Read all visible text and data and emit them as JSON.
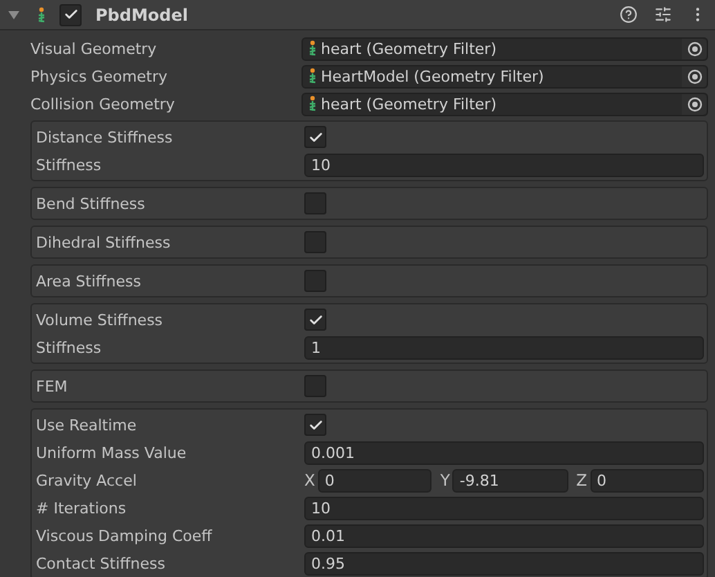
{
  "component": {
    "title": "PbdModel",
    "enabled": true,
    "expanded": true
  },
  "object_fields": [
    {
      "label": "Visual Geometry",
      "value": "heart (Geometry Filter)"
    },
    {
      "label": "Physics Geometry",
      "value": "HeartModel (Geometry Filter)"
    },
    {
      "label": "Collision Geometry",
      "value": "heart (Geometry Filter)"
    }
  ],
  "groups": [
    {
      "rows": [
        {
          "kind": "checkbox",
          "label": "Distance Stiffness",
          "checked": true
        },
        {
          "kind": "text",
          "label": "Stiffness",
          "value": "10"
        }
      ]
    },
    {
      "rows": [
        {
          "kind": "checkbox",
          "label": "Bend Stiffness",
          "checked": false
        }
      ]
    },
    {
      "rows": [
        {
          "kind": "checkbox",
          "label": "Dihedral Stiffness",
          "checked": false
        }
      ]
    },
    {
      "rows": [
        {
          "kind": "checkbox",
          "label": "Area Stiffness",
          "checked": false
        }
      ]
    },
    {
      "rows": [
        {
          "kind": "checkbox",
          "label": "Volume Stiffness",
          "checked": true
        },
        {
          "kind": "text",
          "label": "Stiffness",
          "value": "1"
        }
      ]
    },
    {
      "rows": [
        {
          "kind": "checkbox",
          "label": "FEM",
          "checked": false
        }
      ]
    },
    {
      "rows": [
        {
          "kind": "checkbox",
          "label": "Use Realtime",
          "checked": true
        },
        {
          "kind": "text",
          "label": "Uniform Mass Value",
          "value": "0.001"
        },
        {
          "kind": "vector",
          "label": "Gravity Accel",
          "components": [
            {
              "axis": "X",
              "value": "0"
            },
            {
              "axis": "Y",
              "value": "-9.81"
            },
            {
              "axis": "Z",
              "value": "0"
            }
          ]
        },
        {
          "kind": "text",
          "label": "# Iterations",
          "value": "10"
        },
        {
          "kind": "text",
          "label": "Viscous Damping Coeff",
          "value": "0.01"
        },
        {
          "kind": "text",
          "label": "Contact Stiffness",
          "value": "0.95"
        }
      ]
    }
  ]
}
